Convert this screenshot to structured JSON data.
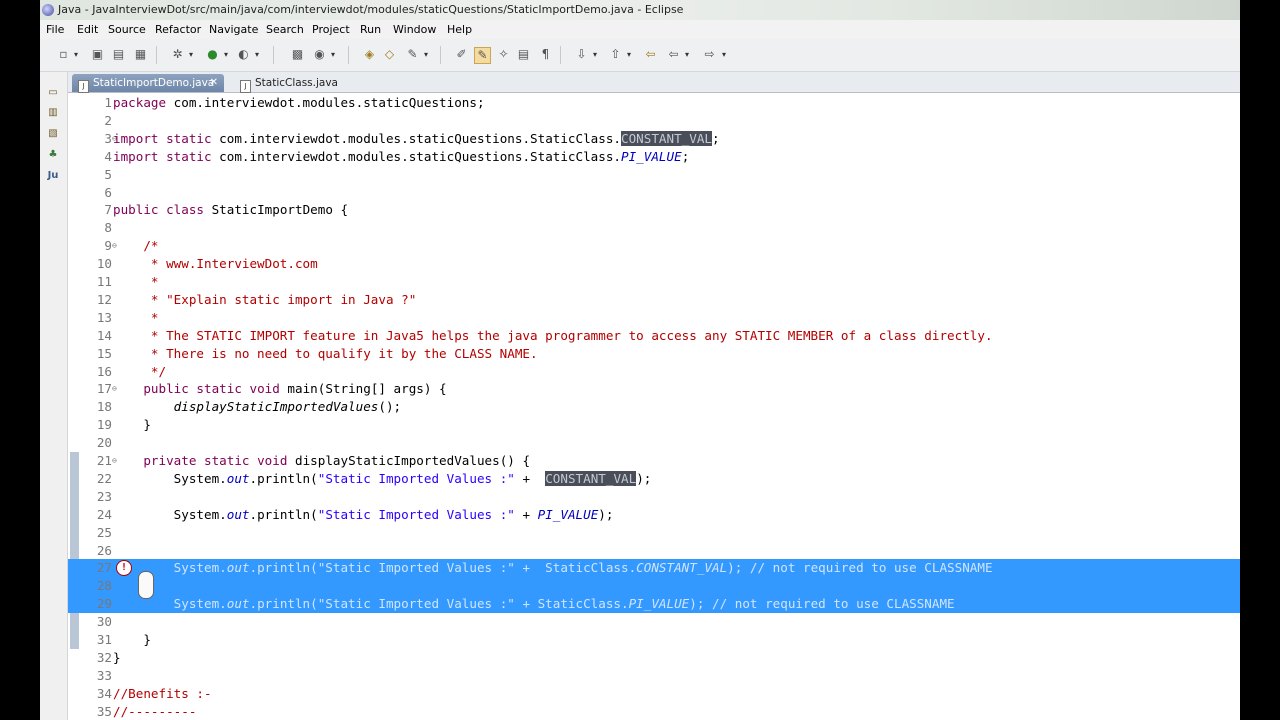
{
  "window": {
    "title": "Java - JavaInterviewDot/src/main/java/com/interviewdot/modules/staticQuestions/StaticImportDemo.java - Eclipse"
  },
  "menu": [
    "File",
    "Edit",
    "Source",
    "Refactor",
    "Navigate",
    "Search",
    "Project",
    "Run",
    "Window",
    "Help"
  ],
  "tabs": [
    {
      "label": "StaticImportDemo.java",
      "close": "✕",
      "active": true
    },
    {
      "label": "StaticClass.java",
      "active": false
    }
  ],
  "lines": [
    {
      "n": "1",
      "segs": [
        {
          "c": "kw",
          "t": "package"
        },
        {
          "t": " com.interviewdot.modules.staticQuestions;"
        }
      ]
    },
    {
      "n": "2",
      "segs": []
    },
    {
      "n": "3",
      "fold": "⊖",
      "segs": [
        {
          "c": "kw",
          "t": "import static"
        },
        {
          "t": " com.interviewdot.modules.staticQuestions.StaticClass."
        },
        {
          "c": "hl",
          "t": "CONSTANT_VAL"
        },
        {
          "t": ";"
        }
      ]
    },
    {
      "n": "4",
      "segs": [
        {
          "c": "kw",
          "t": "import static"
        },
        {
          "t": " com.interviewdot.modules.staticQuestions.StaticClass."
        },
        {
          "c": "fi",
          "t": "PI_VALUE"
        },
        {
          "t": ";"
        }
      ]
    },
    {
      "n": "5",
      "segs": []
    },
    {
      "n": "6",
      "segs": []
    },
    {
      "n": "7",
      "segs": [
        {
          "c": "kw",
          "t": "public class"
        },
        {
          "t": " StaticImportDemo {"
        }
      ]
    },
    {
      "n": "8",
      "segs": []
    },
    {
      "n": "9",
      "fold": "⊖",
      "segs": [
        {
          "c": "cm",
          "t": "    /*"
        }
      ]
    },
    {
      "n": "10",
      "segs": [
        {
          "c": "cm",
          "t": "     * www.InterviewDot.com"
        }
      ]
    },
    {
      "n": "11",
      "segs": [
        {
          "c": "cm",
          "t": "     *"
        }
      ]
    },
    {
      "n": "12",
      "segs": [
        {
          "c": "cm",
          "t": "     * \"Explain static import in Java ?\""
        }
      ]
    },
    {
      "n": "13",
      "segs": [
        {
          "c": "cm",
          "t": "     *"
        }
      ]
    },
    {
      "n": "14",
      "segs": [
        {
          "c": "cm",
          "t": "     * The STATIC IMPORT feature in Java5 helps the java programmer to access any STATIC MEMBER of a class directly."
        }
      ]
    },
    {
      "n": "15",
      "segs": [
        {
          "c": "cm",
          "t": "     * There is no need to qualify it by the CLASS NAME."
        }
      ]
    },
    {
      "n": "16",
      "segs": [
        {
          "c": "cm",
          "t": "     */"
        }
      ]
    },
    {
      "n": "17",
      "fold": "⊖",
      "segs": [
        {
          "t": "    "
        },
        {
          "c": "kw",
          "t": "public static void"
        },
        {
          "t": " main(String[] args) {"
        }
      ]
    },
    {
      "n": "18",
      "segs": [
        {
          "t": "        "
        },
        {
          "c": "mt",
          "t": "displayStaticImportedValues"
        },
        {
          "t": "();"
        }
      ]
    },
    {
      "n": "19",
      "segs": [
        {
          "t": "    }"
        }
      ]
    },
    {
      "n": "20",
      "segs": []
    },
    {
      "n": "21",
      "fold": "⊖",
      "segs": [
        {
          "t": "    "
        },
        {
          "c": "kw",
          "t": "private static void"
        },
        {
          "t": " displayStaticImportedValues() {"
        }
      ]
    },
    {
      "n": "22",
      "segs": [
        {
          "t": "        System."
        },
        {
          "c": "fi",
          "t": "out"
        },
        {
          "t": ".println("
        },
        {
          "c": "st",
          "t": "\"Static Imported Values :\""
        },
        {
          "t": " +  "
        },
        {
          "c": "hl",
          "t": "CONSTANT_VAL"
        },
        {
          "t": ");"
        }
      ]
    },
    {
      "n": "23",
      "segs": []
    },
    {
      "n": "24",
      "segs": [
        {
          "t": "        System."
        },
        {
          "c": "fi",
          "t": "out"
        },
        {
          "t": ".println("
        },
        {
          "c": "st",
          "t": "\"Static Imported Values :\""
        },
        {
          "t": " + "
        },
        {
          "c": "fi",
          "t": "PI_VALUE"
        },
        {
          "t": ");"
        }
      ]
    },
    {
      "n": "25",
      "segs": []
    },
    {
      "n": "26",
      "segs": []
    },
    {
      "n": "27",
      "sel": true,
      "segs": [
        {
          "t": "        System."
        },
        {
          "c": "fi",
          "t": "out"
        },
        {
          "t": ".println(\"Static Imported Values :\" +  StaticClass."
        },
        {
          "c": "fi",
          "t": "CONSTANT_VAL"
        },
        {
          "t": "); // not required to use CLASSNAME"
        }
      ]
    },
    {
      "n": "28",
      "sel": true,
      "segs": []
    },
    {
      "n": "29",
      "sel": true,
      "segs": [
        {
          "t": "        System."
        },
        {
          "c": "fi",
          "t": "out"
        },
        {
          "t": ".println(\"Static Imported Values :\" + StaticClass."
        },
        {
          "c": "fi",
          "t": "PI_VALUE"
        },
        {
          "t": "); // not required to use CLASSNAME"
        }
      ]
    },
    {
      "n": "30",
      "segs": []
    },
    {
      "n": "31",
      "segs": [
        {
          "t": "    }"
        }
      ]
    },
    {
      "n": "32",
      "segs": [
        {
          "t": "}"
        }
      ]
    },
    {
      "n": "33",
      "segs": []
    },
    {
      "n": "34",
      "segs": [
        {
          "c": "cm",
          "t": "//Benefits :-"
        }
      ]
    },
    {
      "n": "35",
      "segs": [
        {
          "c": "cm",
          "t": "//---------"
        }
      ]
    }
  ]
}
